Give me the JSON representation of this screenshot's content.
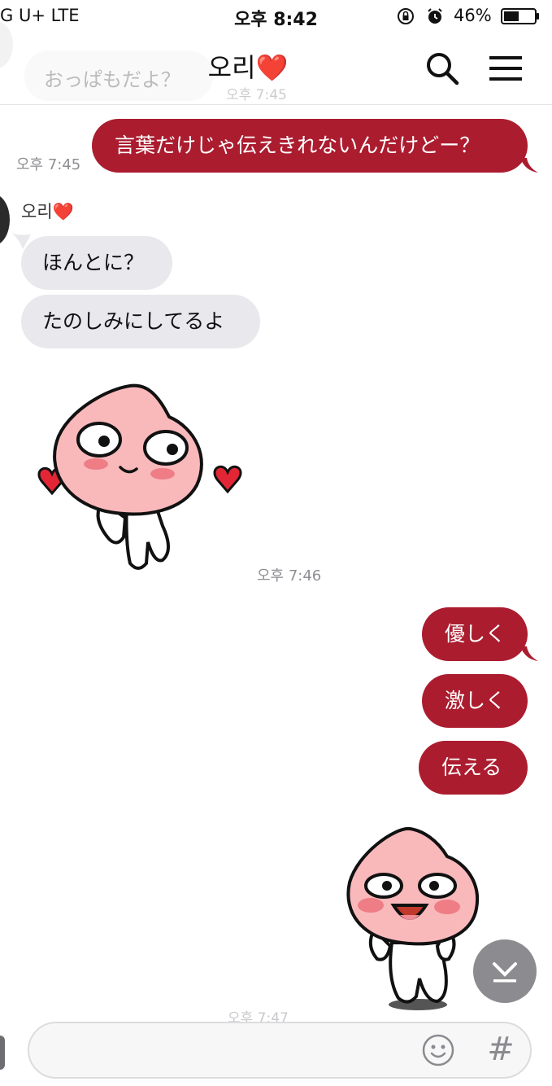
{
  "status_bar": {
    "carrier": "G U+  LTE",
    "time": "오후 8:42",
    "battery": "46%"
  },
  "header": {
    "title": "오리❤️",
    "ghost_name": "오리❤️",
    "ghost_message": "おっぱもだよ？",
    "ghost_time": "오후 7:45"
  },
  "messages": {
    "m1": {
      "text": "言葉だけじゃ伝えきれないんだけどー？",
      "time": "오후 7:45"
    },
    "sender": "오리❤️",
    "m2": {
      "text": "ほんとに？"
    },
    "m3": {
      "text": "たのしみにしてるよ"
    },
    "sticker1": {
      "name": "apeach-shy-hearts-sticker",
      "time": "오후 7:46"
    },
    "m4": {
      "text": "優しく"
    },
    "m5": {
      "text": "激しく"
    },
    "m6": {
      "text": "伝える"
    },
    "sticker2": {
      "name": "apeach-happy-sticker",
      "time": "오후 7:47"
    }
  },
  "input": {
    "placeholder": "",
    "hashtag": "#"
  },
  "colors": {
    "my_bubble": "#ab1c2f",
    "their_bubble": "#e8e8ed",
    "time_text": "#8e8e93"
  }
}
